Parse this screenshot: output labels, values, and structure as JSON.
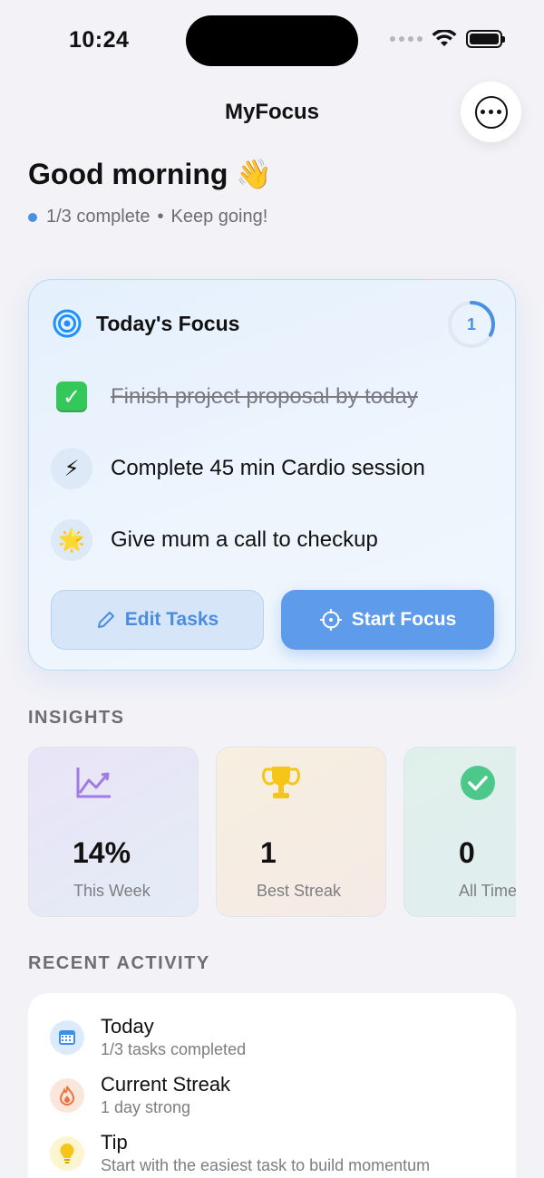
{
  "status_bar": {
    "time": "10:24"
  },
  "nav": {
    "title": "MyFocus",
    "more_icon": "ellipsis-circle-icon"
  },
  "greeting": "Good morning 👋",
  "progress": {
    "summary": "1/3 complete",
    "separator": "•",
    "message": "Keep going!"
  },
  "focus_card": {
    "title": "Today's Focus",
    "completed_count": "1",
    "completion_fraction": 0.33,
    "tasks": [
      {
        "icon": "checkmark-box-icon",
        "emoji": "✓",
        "text": "Finish project proposal by today",
        "done": true
      },
      {
        "icon": "lightning-icon",
        "emoji": "⚡",
        "text": "Complete 45 min Cardio session",
        "done": false
      },
      {
        "icon": "star-icon",
        "emoji": "🌟",
        "text": "Give mum a call to checkup",
        "done": false
      }
    ],
    "edit_label": "Edit Tasks",
    "start_label": "Start Focus"
  },
  "insights": {
    "label": "INSIGHTS",
    "cards": [
      {
        "icon": "chart-line-icon",
        "value": "14%",
        "label": "This Week"
      },
      {
        "icon": "trophy-icon",
        "value": "1",
        "label": "Best Streak"
      },
      {
        "icon": "checkmark-circle-icon",
        "value": "0",
        "label": "All Time"
      }
    ]
  },
  "recent_activity": {
    "label": "RECENT ACTIVITY",
    "items": [
      {
        "icon": "calendar-icon",
        "title": "Today",
        "subtitle": "1/3 tasks completed"
      },
      {
        "icon": "flame-icon",
        "title": "Current Streak",
        "subtitle": "1 day strong"
      },
      {
        "icon": "lightbulb-icon",
        "title": "Tip",
        "subtitle": "Start with the easiest task to build momentum"
      }
    ]
  },
  "colors": {
    "accent": "#4a90e2",
    "success": "#34c759",
    "trophy": "#f5c518",
    "chart": "#a07be0"
  }
}
